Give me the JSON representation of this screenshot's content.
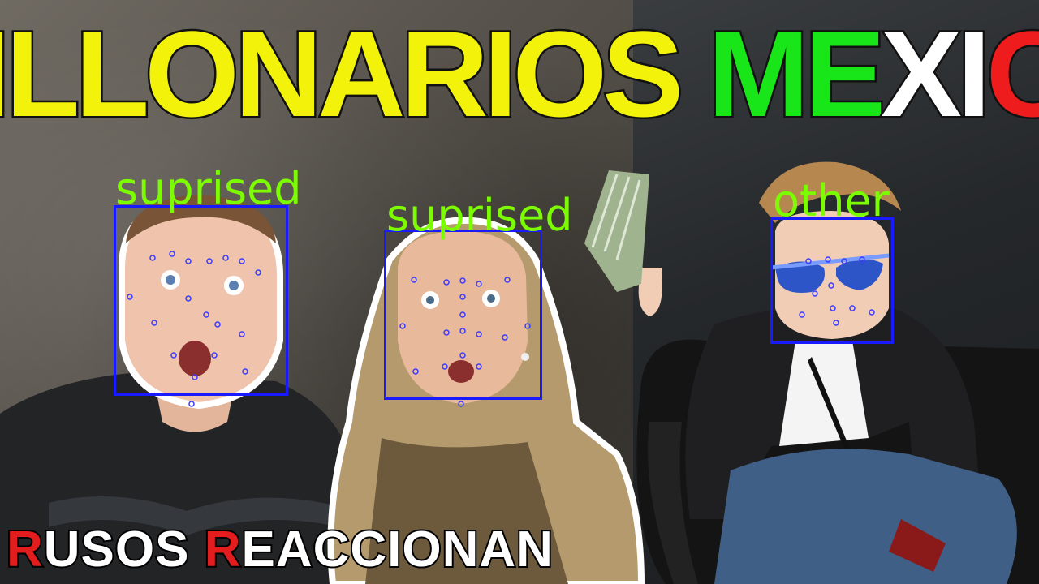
{
  "title": {
    "word1": "MILLONARIOS",
    "word2_green": "ME",
    "word2_white": "XI",
    "word2_red": "CO",
    "colors": {
      "yellow": "#f2f20a",
      "green": "#19e619",
      "white": "#ffffff",
      "red": "#ee1c1c"
    }
  },
  "faces": [
    {
      "emotion": "suprised"
    },
    {
      "emotion": "suprised"
    },
    {
      "emotion": "other"
    }
  ],
  "bottom_title": {
    "r1": "R",
    "rest1": "USOS ",
    "r2": "R",
    "rest2": "EACCIONAN"
  },
  "colors": {
    "box": "#1a1aff",
    "label": "#7cfc00"
  }
}
